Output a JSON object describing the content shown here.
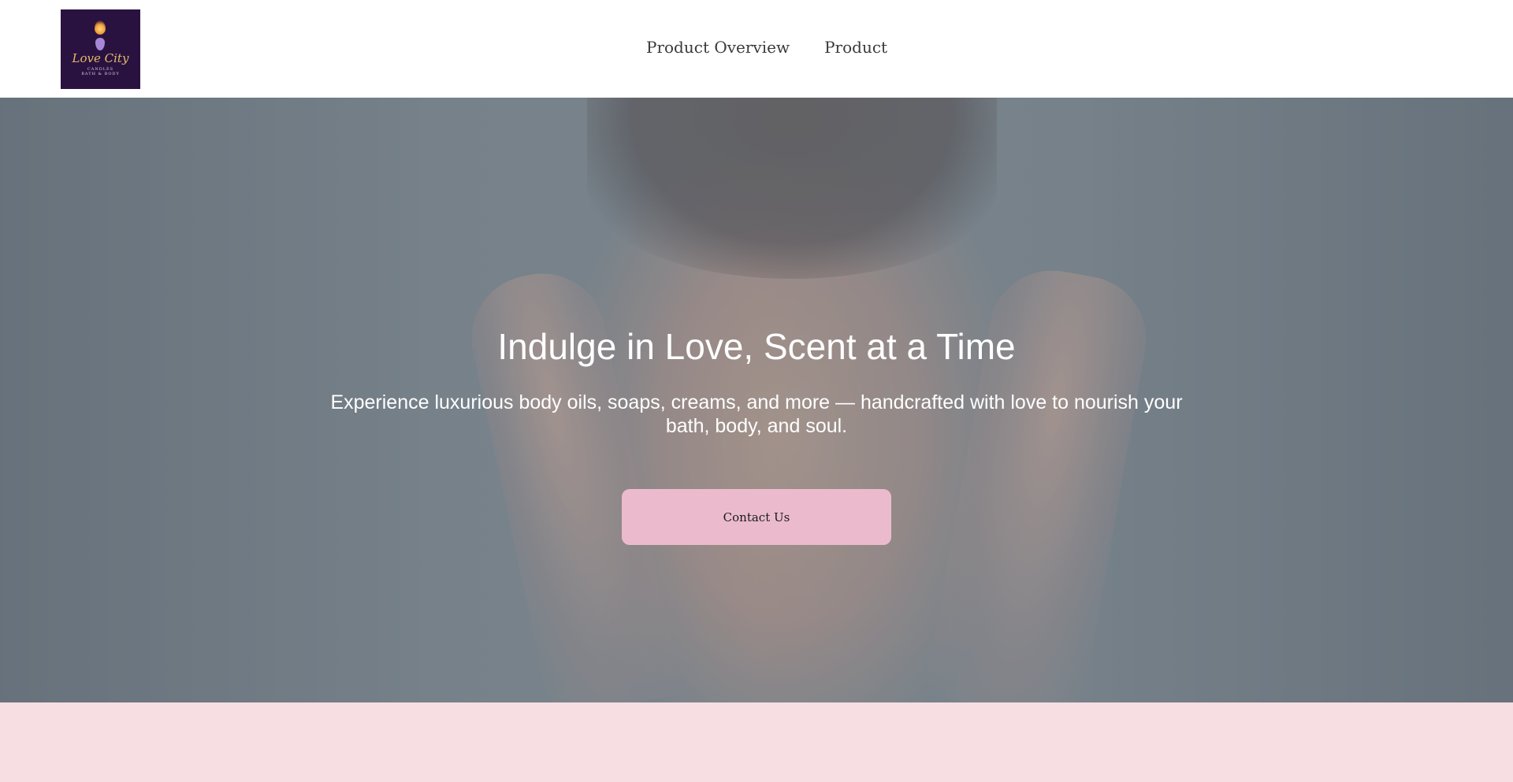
{
  "header": {
    "logo": {
      "title": "Love City",
      "line1": "CANDLES",
      "line2": "BATH & BODY"
    },
    "nav": [
      {
        "label": "Product Overview"
      },
      {
        "label": "Product"
      }
    ]
  },
  "hero": {
    "title": "Indulge in Love, Scent at a Time",
    "subtitle": "Experience luxurious body oils, soaps, creams, and more — handcrafted with love to nourish your bath, body, and soul.",
    "button_label": "Contact Us"
  },
  "colors": {
    "logo_background": "#2a1240",
    "button_background": "#ebbbcd",
    "footer_band": "#f6dee3",
    "hero_text": "#ffffff"
  }
}
